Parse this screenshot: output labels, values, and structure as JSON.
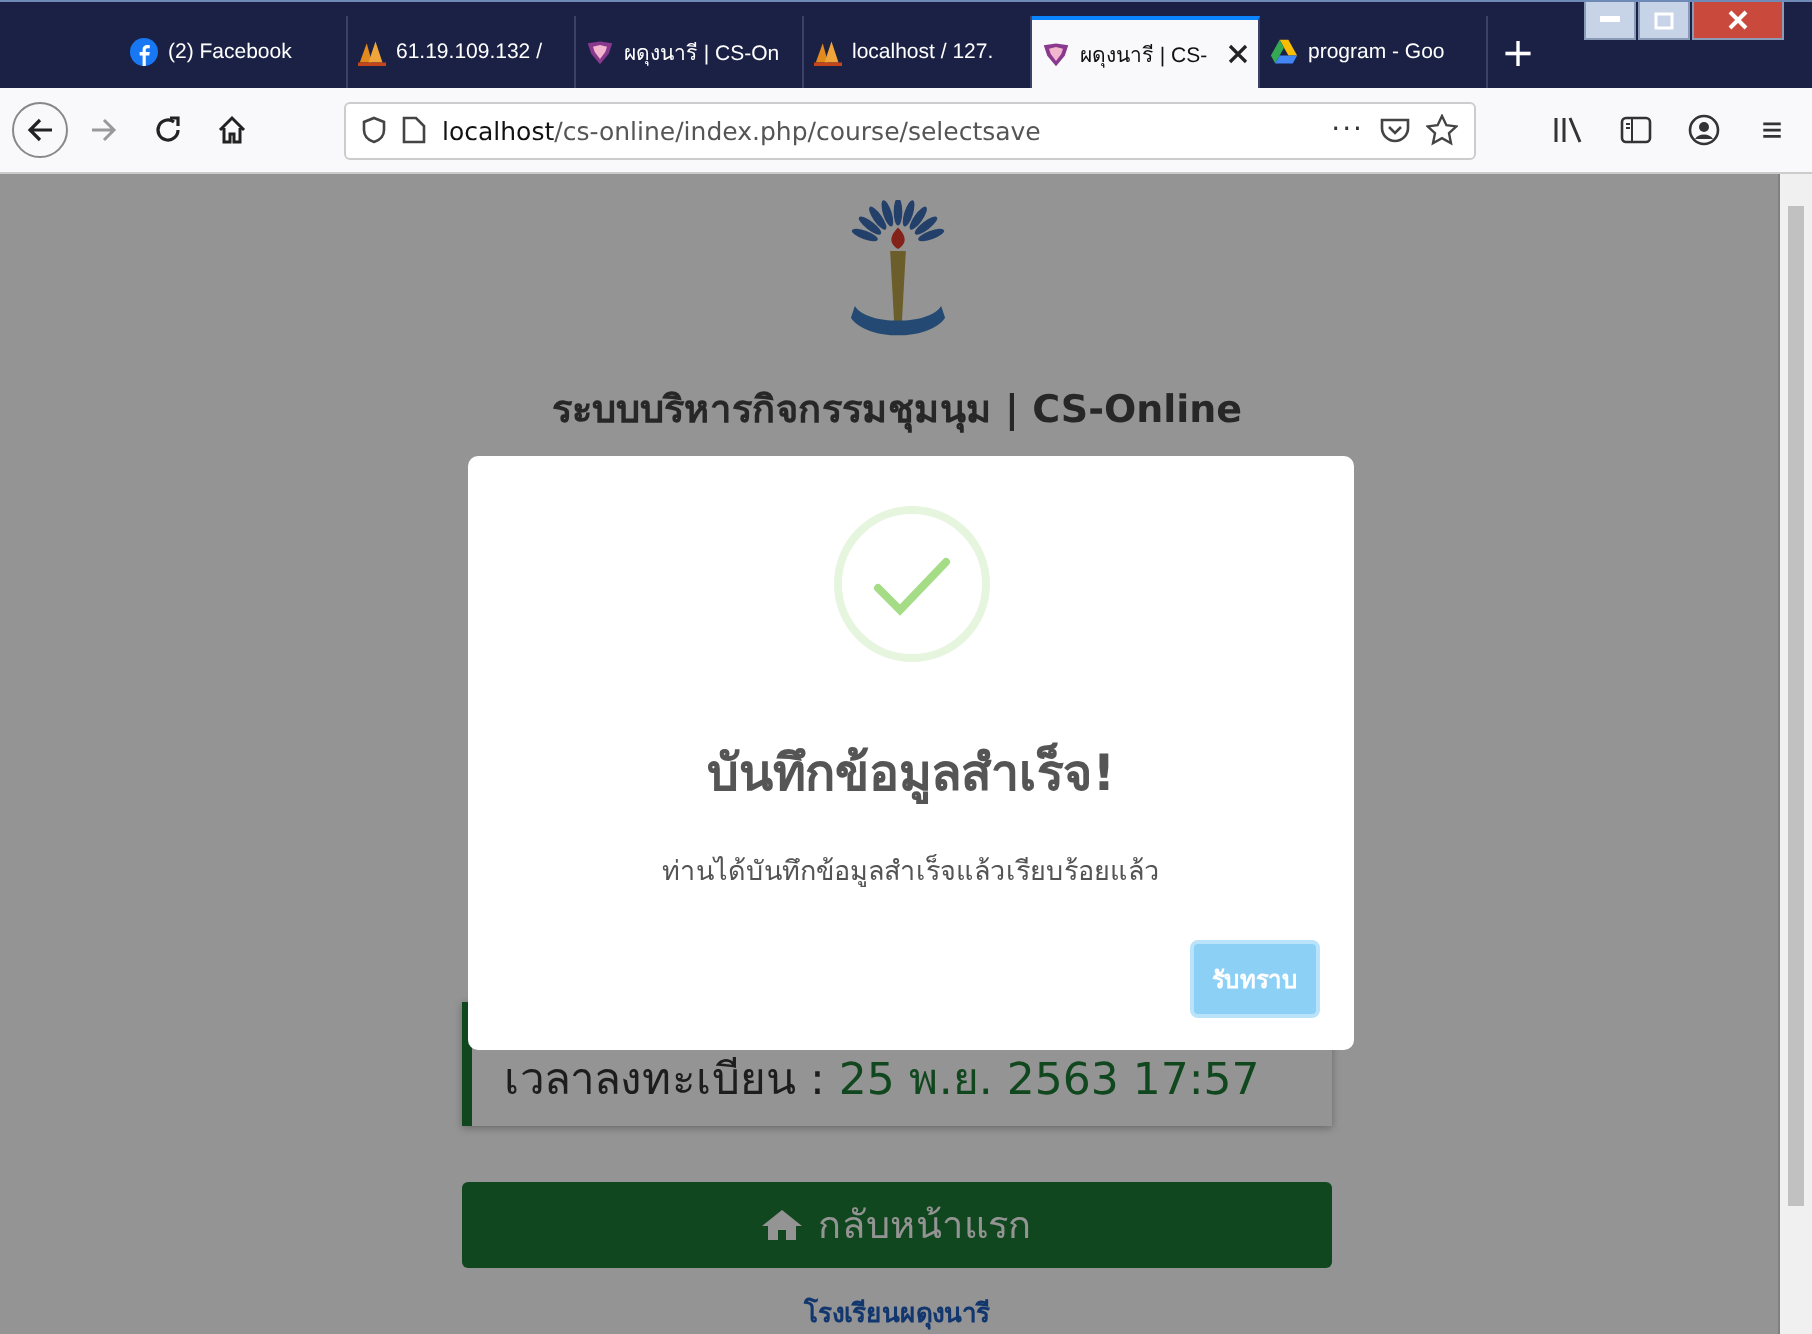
{
  "tabs": [
    {
      "label": "(2) Facebook",
      "kind": "facebook",
      "selected": false
    },
    {
      "label": "61.19.109.132 /",
      "kind": "sail",
      "selected": false
    },
    {
      "label": "ผดุงนารี | CS-On",
      "kind": "shield",
      "selected": false
    },
    {
      "label": "localhost / 127.",
      "kind": "sail",
      "selected": false
    },
    {
      "label": "ผดุงนารี | CS-",
      "kind": "shield",
      "selected": true
    },
    {
      "label": "program - Goo",
      "kind": "drive",
      "selected": false
    }
  ],
  "new_tab": "+",
  "address_bar": {
    "host": "localhost",
    "path": "/cs-online/index.php/course/selectsave",
    "more": "···"
  },
  "menu_glyph": "≡",
  "page": {
    "title": "ระบบบริหารกิจกรรมชุมนุม | CS-Online",
    "card": {
      "label": "เวลาลงทะเบียน : ",
      "value": "25 พ.ย. 2563 17:57"
    },
    "home_button": "กลับหน้าแรก",
    "footer_link": "โรงเรียนผดุงนารี"
  },
  "dialog": {
    "kind": "success",
    "title": "บันทึกข้อมูลสำเร็จ!",
    "message": "ท่านได้บันทึกข้อมูลสำเร็จแล้วเรียบร้อยแล้ว",
    "confirm": "รับทราบ"
  }
}
